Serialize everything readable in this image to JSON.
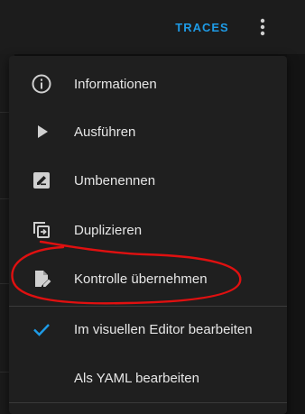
{
  "toolbar": {
    "traces_label": "TRACES",
    "more_icon": "more-vertical-icon"
  },
  "menu": {
    "items": [
      {
        "label": "Informationen",
        "icon": "info-icon"
      },
      {
        "label": "Ausführen",
        "icon": "play-icon"
      },
      {
        "label": "Umbenennen",
        "icon": "rename-icon"
      },
      {
        "label": "Duplizieren",
        "icon": "duplicate-icon"
      },
      {
        "label": "Kontrolle übernehmen",
        "icon": "file-edit-icon"
      },
      {
        "label": "Im visuellen Editor bearbeiten",
        "icon": "check-icon",
        "checked": true
      },
      {
        "label": "Als YAML bearbeiten",
        "icon": "",
        "checked": false
      }
    ]
  },
  "colors": {
    "accent": "#1e9be6",
    "annotation": "#e01010",
    "menu_bg": "#1f1f1f",
    "text": "#e6e6e6",
    "icon": "#d0d0d0"
  }
}
